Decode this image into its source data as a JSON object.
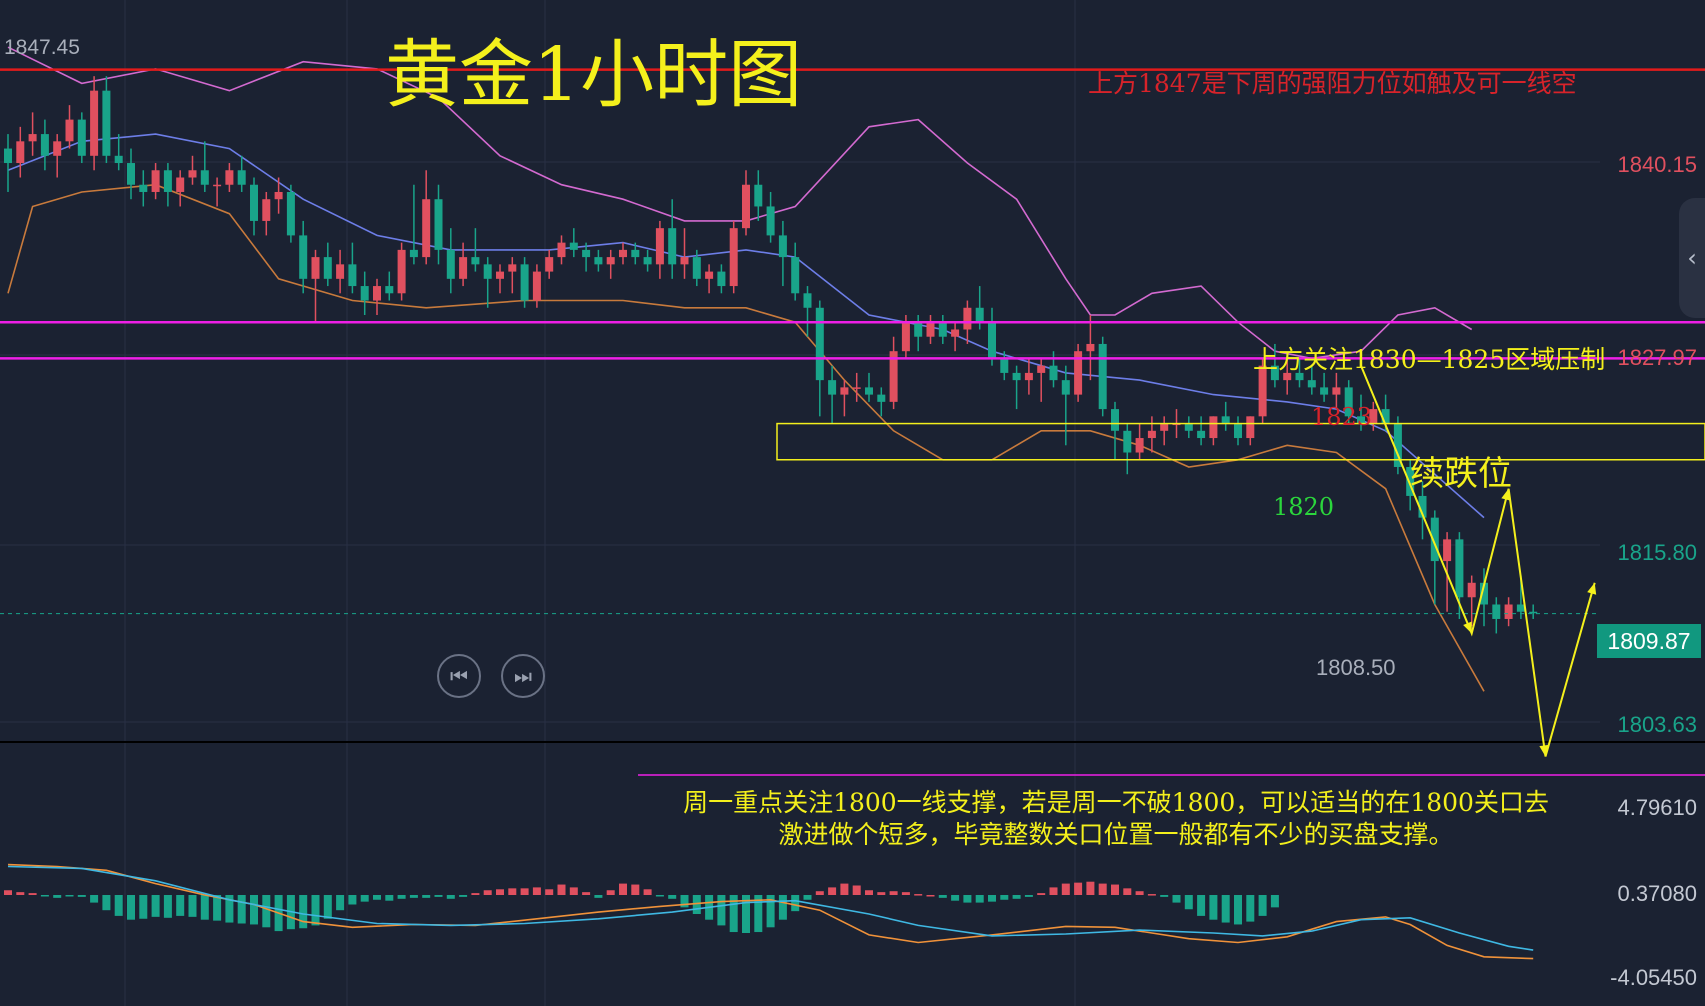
{
  "title": "黄金1小时图",
  "annotations": {
    "resistance_note": "上方1847是下周的强阻力位如触及可一线空",
    "pressure_note": "上方关注1830—1825区域压制",
    "continue_drop": "续跌位",
    "label_1823": "1823",
    "label_1820": "1820",
    "bottom_line1": "周一重点关注1800一线支撑，若是周一不破1800，可以适当的在1800关口去",
    "bottom_line2": "激进做个短多，毕竟整数关口位置一般都有不少的买盘支撑。"
  },
  "price_axis": {
    "high_label": "1847.45",
    "ticks": [
      "1840.15",
      "1827.97",
      "1815.80",
      "1803.63"
    ],
    "current_price": "1809.87",
    "low_label": "1808.50"
  },
  "macd_axis": {
    "ticks": [
      "4.79610",
      "0.37080",
      "-4.05450"
    ]
  },
  "controls": {
    "prev_icon": "skip-back-icon",
    "next_icon": "skip-forward-icon",
    "expand_icon": "chevron-left-icon"
  },
  "colors": {
    "background": "#1b2232",
    "up_candle": "#e0505f",
    "down_candle": "#19a48a",
    "resistance_line": "#e31b1b",
    "zone_line": "#ee1fe6",
    "box_line": "#f4f01c",
    "annotation_yellow": "#f4f01c",
    "boll_upper": "#d36ad0",
    "boll_mid": "#6d7ee8",
    "boll_lower": "#c87a3c"
  },
  "chart_data": {
    "type": "candlestick",
    "timeframe": "1H",
    "ylim": [
      1801.0,
      1849.5
    ],
    "horizontal_lines": [
      {
        "price": 1847.45,
        "color": "#e31b1b"
      },
      {
        "price": 1830.0,
        "color": "#ee1fe6"
      },
      {
        "price": 1827.5,
        "color": "#ee1fe6"
      }
    ],
    "zone_box": {
      "top": 1823.0,
      "bottom": 1820.5
    },
    "candles": [
      [
        1842.0,
        1843.0,
        1839.0,
        1841.0
      ],
      [
        1841.0,
        1843.5,
        1840.0,
        1842.5
      ],
      [
        1842.5,
        1844.5,
        1841.5,
        1843.0
      ],
      [
        1843.0,
        1844.0,
        1840.5,
        1841.5
      ],
      [
        1841.5,
        1843.0,
        1840.0,
        1842.5
      ],
      [
        1842.5,
        1845.0,
        1842.0,
        1844.0
      ],
      [
        1844.0,
        1844.5,
        1841.0,
        1841.5
      ],
      [
        1841.5,
        1847.0,
        1840.5,
        1846.0
      ],
      [
        1846.0,
        1847.0,
        1841.0,
        1841.5
      ],
      [
        1841.5,
        1843.0,
        1840.5,
        1841.0
      ],
      [
        1841.0,
        1842.0,
        1838.5,
        1839.5
      ],
      [
        1839.5,
        1840.5,
        1838.0,
        1839.0
      ],
      [
        1839.0,
        1841.0,
        1838.5,
        1840.5
      ],
      [
        1840.5,
        1841.0,
        1838.0,
        1839.0
      ],
      [
        1839.0,
        1840.5,
        1838.0,
        1840.0
      ],
      [
        1840.0,
        1841.5,
        1839.5,
        1840.5
      ],
      [
        1840.5,
        1842.5,
        1839.0,
        1839.5
      ],
      [
        1839.5,
        1840.0,
        1838.0,
        1839.5
      ],
      [
        1839.5,
        1841.0,
        1839.0,
        1840.5
      ],
      [
        1840.5,
        1841.5,
        1839.0,
        1839.5
      ],
      [
        1839.5,
        1840.0,
        1836.0,
        1837.0
      ],
      [
        1837.0,
        1839.0,
        1836.0,
        1838.5
      ],
      [
        1838.5,
        1840.0,
        1837.5,
        1839.0
      ],
      [
        1839.0,
        1839.5,
        1835.5,
        1836.0
      ],
      [
        1836.0,
        1837.0,
        1832.0,
        1833.0
      ],
      [
        1833.0,
        1835.0,
        1830.0,
        1834.5
      ],
      [
        1834.5,
        1835.5,
        1832.5,
        1833.0
      ],
      [
        1833.0,
        1835.0,
        1832.0,
        1834.0
      ],
      [
        1834.0,
        1835.5,
        1832.0,
        1832.5
      ],
      [
        1832.5,
        1833.5,
        1830.5,
        1831.5
      ],
      [
        1831.5,
        1833.0,
        1830.5,
        1832.5
      ],
      [
        1832.5,
        1833.5,
        1831.5,
        1832.0
      ],
      [
        1832.0,
        1835.5,
        1831.5,
        1835.0
      ],
      [
        1835.0,
        1839.5,
        1834.0,
        1834.5
      ],
      [
        1834.5,
        1840.5,
        1834.0,
        1838.5
      ],
      [
        1838.5,
        1839.5,
        1834.0,
        1835.0
      ],
      [
        1835.0,
        1836.5,
        1832.0,
        1833.0
      ],
      [
        1833.0,
        1835.5,
        1832.5,
        1834.5
      ],
      [
        1834.5,
        1836.5,
        1833.5,
        1834.0
      ],
      [
        1834.0,
        1834.5,
        1831.0,
        1833.0
      ],
      [
        1833.0,
        1834.0,
        1832.0,
        1833.5
      ],
      [
        1833.5,
        1834.5,
        1832.0,
        1834.0
      ],
      [
        1834.0,
        1834.5,
        1831.0,
        1831.5
      ],
      [
        1831.5,
        1834.0,
        1831.0,
        1833.5
      ],
      [
        1833.5,
        1835.0,
        1833.0,
        1834.5
      ],
      [
        1834.5,
        1836.0,
        1834.0,
        1835.5
      ],
      [
        1835.5,
        1836.5,
        1834.5,
        1835.0
      ],
      [
        1835.0,
        1835.5,
        1833.5,
        1834.5
      ],
      [
        1834.5,
        1835.0,
        1833.5,
        1834.0
      ],
      [
        1834.0,
        1835.0,
        1833.0,
        1834.5
      ],
      [
        1834.5,
        1835.5,
        1834.0,
        1835.0
      ],
      [
        1835.0,
        1835.5,
        1834.0,
        1834.5
      ],
      [
        1834.5,
        1835.0,
        1833.5,
        1834.0
      ],
      [
        1834.0,
        1837.0,
        1833.0,
        1836.5
      ],
      [
        1836.5,
        1838.5,
        1833.0,
        1834.0
      ],
      [
        1834.0,
        1836.5,
        1833.0,
        1834.5
      ],
      [
        1834.5,
        1835.0,
        1832.5,
        1833.0
      ],
      [
        1833.0,
        1834.0,
        1832.0,
        1833.5
      ],
      [
        1833.5,
        1834.0,
        1832.0,
        1832.5
      ],
      [
        1832.5,
        1837.0,
        1832.0,
        1836.5
      ],
      [
        1836.5,
        1840.5,
        1836.0,
        1839.5
      ],
      [
        1839.5,
        1840.5,
        1837.0,
        1838.0
      ],
      [
        1838.0,
        1839.0,
        1835.5,
        1836.0
      ],
      [
        1836.0,
        1837.0,
        1832.5,
        1834.5
      ],
      [
        1834.5,
        1835.5,
        1831.5,
        1832.0
      ],
      [
        1832.0,
        1832.5,
        1829.0,
        1831.0
      ],
      [
        1831.0,
        1831.5,
        1823.5,
        1826.0
      ],
      [
        1826.0,
        1827.0,
        1823.0,
        1825.0
      ],
      [
        1825.0,
        1826.0,
        1823.5,
        1825.5
      ],
      [
        1825.5,
        1826.5,
        1824.5,
        1825.5
      ],
      [
        1825.5,
        1826.5,
        1824.5,
        1825.0
      ],
      [
        1825.0,
        1825.5,
        1823.5,
        1824.5
      ],
      [
        1824.5,
        1829.0,
        1824.0,
        1828.0
      ],
      [
        1828.0,
        1830.5,
        1827.5,
        1830.0
      ],
      [
        1830.0,
        1830.5,
        1828.0,
        1829.0
      ],
      [
        1829.0,
        1830.5,
        1828.5,
        1830.0
      ],
      [
        1830.0,
        1830.5,
        1828.5,
        1829.0
      ],
      [
        1829.0,
        1830.0,
        1828.0,
        1829.5
      ],
      [
        1829.5,
        1831.5,
        1828.5,
        1831.0
      ],
      [
        1831.0,
        1832.5,
        1829.5,
        1830.0
      ],
      [
        1830.0,
        1831.0,
        1827.0,
        1827.5
      ],
      [
        1827.5,
        1828.0,
        1826.0,
        1826.5
      ],
      [
        1826.5,
        1827.0,
        1824.0,
        1826.0
      ],
      [
        1826.0,
        1827.5,
        1825.0,
        1826.5
      ],
      [
        1826.5,
        1827.5,
        1824.5,
        1827.0
      ],
      [
        1827.0,
        1828.0,
        1825.5,
        1826.0
      ],
      [
        1826.0,
        1827.0,
        1821.5,
        1825.0
      ],
      [
        1825.0,
        1828.5,
        1824.5,
        1828.0
      ],
      [
        1828.0,
        1830.5,
        1826.0,
        1828.5
      ],
      [
        1828.5,
        1829.0,
        1823.5,
        1824.0
      ],
      [
        1824.0,
        1824.5,
        1820.5,
        1822.5
      ],
      [
        1822.5,
        1823.0,
        1819.5,
        1821.0
      ],
      [
        1821.0,
        1823.0,
        1820.5,
        1822.0
      ],
      [
        1822.0,
        1823.5,
        1821.0,
        1822.5
      ],
      [
        1822.5,
        1823.5,
        1821.5,
        1823.0
      ],
      [
        1823.0,
        1824.0,
        1822.0,
        1823.0
      ],
      [
        1823.0,
        1823.5,
        1822.0,
        1822.5
      ],
      [
        1822.5,
        1823.5,
        1821.5,
        1822.0
      ],
      [
        1822.0,
        1823.5,
        1821.5,
        1823.5
      ],
      [
        1823.5,
        1824.5,
        1822.5,
        1823.0
      ],
      [
        1823.0,
        1823.5,
        1821.5,
        1822.0
      ],
      [
        1822.0,
        1823.5,
        1821.5,
        1823.5
      ],
      [
        1823.5,
        1827.5,
        1823.0,
        1827.0
      ],
      [
        1827.0,
        1828.5,
        1825.5,
        1826.0
      ],
      [
        1826.0,
        1827.5,
        1825.0,
        1826.5
      ],
      [
        1826.5,
        1827.5,
        1825.5,
        1826.0
      ],
      [
        1826.0,
        1827.0,
        1825.0,
        1825.5
      ],
      [
        1825.5,
        1826.5,
        1824.5,
        1825.0
      ],
      [
        1825.0,
        1826.5,
        1824.0,
        1825.5
      ],
      [
        1825.5,
        1826.0,
        1823.0,
        1823.5
      ],
      [
        1823.5,
        1825.0,
        1822.5,
        1823.0
      ],
      [
        1823.0,
        1824.5,
        1822.5,
        1824.0
      ],
      [
        1824.0,
        1825.0,
        1822.5,
        1823.0
      ],
      [
        1823.0,
        1823.5,
        1819.5,
        1820.0
      ],
      [
        1820.0,
        1820.5,
        1817.0,
        1818.0
      ],
      [
        1818.0,
        1819.0,
        1815.0,
        1816.5
      ],
      [
        1816.5,
        1817.0,
        1810.5,
        1813.5
      ],
      [
        1813.5,
        1815.5,
        1810.0,
        1815.0
      ],
      [
        1815.0,
        1815.5,
        1809.5,
        1811.0
      ],
      [
        1811.0,
        1812.5,
        1809.0,
        1812.0
      ],
      [
        1812.0,
        1813.0,
        1809.0,
        1810.5
      ],
      [
        1810.5,
        1811.0,
        1808.5,
        1809.5
      ],
      [
        1809.5,
        1811.0,
        1809.0,
        1810.5
      ],
      [
        1810.5,
        1812.5,
        1809.5,
        1810.0
      ],
      [
        1810.0,
        1810.5,
        1809.5,
        1809.9
      ]
    ],
    "boll_upper": [
      [
        0,
        1849.0
      ],
      [
        6,
        1846.5
      ],
      [
        12,
        1847.5
      ],
      [
        18,
        1846.0
      ],
      [
        24,
        1848.0
      ],
      [
        30,
        1847.5
      ],
      [
        35,
        1845.5
      ],
      [
        40,
        1841.5
      ],
      [
        45,
        1839.5
      ],
      [
        50,
        1838.5
      ],
      [
        55,
        1837.0
      ],
      [
        60,
        1837.0
      ],
      [
        64,
        1838.0
      ],
      [
        70,
        1843.5
      ],
      [
        74,
        1844.0
      ],
      [
        78,
        1841.0
      ],
      [
        82,
        1838.5
      ],
      [
        86,
        1833.0
      ],
      [
        88,
        1830.5
      ],
      [
        90,
        1830.5
      ],
      [
        93,
        1832.0
      ],
      [
        97,
        1832.5
      ],
      [
        100,
        1830.0
      ],
      [
        103,
        1828.0
      ],
      [
        106,
        1827.5
      ],
      [
        110,
        1828.0
      ],
      [
        113,
        1830.5
      ],
      [
        116,
        1831.0
      ],
      [
        119,
        1829.5
      ]
    ],
    "boll_mid": [
      [
        0,
        1840.5
      ],
      [
        6,
        1842.5
      ],
      [
        12,
        1843.0
      ],
      [
        18,
        1842.0
      ],
      [
        24,
        1838.5
      ],
      [
        30,
        1836.0
      ],
      [
        36,
        1835.0
      ],
      [
        44,
        1835.0
      ],
      [
        50,
        1835.5
      ],
      [
        55,
        1834.5
      ],
      [
        60,
        1835.0
      ],
      [
        64,
        1834.5
      ],
      [
        70,
        1830.5
      ],
      [
        76,
        1829.5
      ],
      [
        80,
        1828.0
      ],
      [
        86,
        1826.5
      ],
      [
        92,
        1826.0
      ],
      [
        98,
        1825.0
      ],
      [
        104,
        1824.5
      ],
      [
        108,
        1824.0
      ],
      [
        112,
        1822.5
      ],
      [
        116,
        1819.5
      ],
      [
        120,
        1816.5
      ]
    ],
    "boll_lower": [
      [
        0,
        1832.0
      ],
      [
        2,
        1838.0
      ],
      [
        6,
        1839.0
      ],
      [
        12,
        1839.5
      ],
      [
        18,
        1837.5
      ],
      [
        22,
        1833.0
      ],
      [
        28,
        1831.5
      ],
      [
        34,
        1831.0
      ],
      [
        42,
        1831.5
      ],
      [
        50,
        1831.5
      ],
      [
        55,
        1831.0
      ],
      [
        60,
        1831.0
      ],
      [
        64,
        1830.0
      ],
      [
        68,
        1826.0
      ],
      [
        72,
        1822.5
      ],
      [
        76,
        1820.5
      ],
      [
        80,
        1820.5
      ],
      [
        84,
        1822.5
      ],
      [
        88,
        1822.5
      ],
      [
        92,
        1821.5
      ],
      [
        96,
        1820.0
      ],
      [
        100,
        1820.5
      ],
      [
        104,
        1821.5
      ],
      [
        108,
        1821.0
      ],
      [
        112,
        1818.5
      ],
      [
        116,
        1810.5
      ],
      [
        120,
        1804.5
      ]
    ],
    "projection": [
      [
        110,
        1827.0
      ],
      [
        119,
        1808.5
      ],
      [
        122,
        1818.5
      ],
      [
        125,
        1800.0
      ],
      [
        129,
        1812.0
      ]
    ],
    "macd_hist": [
      0.5,
      0.3,
      0.2,
      -0.1,
      -0.3,
      -0.1,
      -0.2,
      -0.8,
      -1.6,
      -2.2,
      -2.6,
      -2.5,
      -2.3,
      -2.4,
      -2.2,
      -2.3,
      -2.6,
      -2.7,
      -2.9,
      -3.0,
      -3.1,
      -3.4,
      -3.8,
      -3.6,
      -3.5,
      -3.2,
      -2.5,
      -1.6,
      -1.0,
      -0.7,
      -0.5,
      -0.6,
      -0.4,
      -0.3,
      -0.3,
      -0.2,
      -0.4,
      -0.2,
      0.2,
      0.5,
      0.6,
      0.7,
      0.7,
      0.8,
      0.6,
      1.1,
      0.8,
      0.3,
      -0.3,
      0.5,
      1.2,
      1.1,
      0.6,
      -0.1,
      -0.4,
      -1.3,
      -2.0,
      -2.6,
      -3.2,
      -3.9,
      -4.0,
      -3.9,
      -3.4,
      -2.6,
      -1.7,
      -0.5,
      0.4,
      0.8,
      1.2,
      1.0,
      0.5,
      0.3,
      0.4,
      0.3,
      0.1,
      0.0,
      -0.3,
      -0.6,
      -0.8,
      -0.8,
      -0.7,
      -0.5,
      -0.4,
      -0.2,
      0.2,
      0.8,
      1.2,
      1.3,
      1.4,
      1.2,
      1.1,
      0.7,
      0.4,
      0.1,
      -0.2,
      -0.8,
      -1.5,
      -2.2,
      -2.6,
      -2.9,
      -3.1,
      -2.8,
      -2.2,
      -1.3
    ],
    "macd_dif": [
      [
        0,
        3.2
      ],
      [
        4,
        3.0
      ],
      [
        8,
        2.6
      ],
      [
        12,
        1.2
      ],
      [
        16,
        0.0
      ],
      [
        20,
        -1.0
      ],
      [
        24,
        -2.8
      ],
      [
        28,
        -3.4
      ],
      [
        33,
        -3.1
      ],
      [
        38,
        -3.2
      ],
      [
        43,
        -2.5
      ],
      [
        48,
        -1.8
      ],
      [
        53,
        -1.2
      ],
      [
        58,
        -0.7
      ],
      [
        62,
        -0.5
      ],
      [
        66,
        -1.6
      ],
      [
        70,
        -4.2
      ],
      [
        74,
        -5.0
      ],
      [
        80,
        -4.2
      ],
      [
        86,
        -3.3
      ],
      [
        90,
        -3.4
      ],
      [
        96,
        -4.6
      ],
      [
        100,
        -5.0
      ],
      [
        104,
        -4.4
      ],
      [
        108,
        -2.8
      ],
      [
        112,
        -2.3
      ],
      [
        114,
        -3.1
      ],
      [
        117,
        -5.3
      ],
      [
        120,
        -6.5
      ],
      [
        124,
        -6.7
      ]
    ],
    "macd_dea": [
      [
        0,
        3.0
      ],
      [
        6,
        2.8
      ],
      [
        12,
        1.5
      ],
      [
        18,
        -0.5
      ],
      [
        24,
        -2.0
      ],
      [
        30,
        -3.0
      ],
      [
        36,
        -3.2
      ],
      [
        42,
        -3.0
      ],
      [
        48,
        -2.5
      ],
      [
        54,
        -1.8
      ],
      [
        60,
        -0.8
      ],
      [
        64,
        -0.6
      ],
      [
        70,
        -2.0
      ],
      [
        74,
        -3.2
      ],
      [
        80,
        -4.3
      ],
      [
        86,
        -4.1
      ],
      [
        92,
        -3.7
      ],
      [
        98,
        -4.0
      ],
      [
        102,
        -4.3
      ],
      [
        106,
        -3.8
      ],
      [
        110,
        -2.6
      ],
      [
        114,
        -2.4
      ],
      [
        118,
        -4.0
      ],
      [
        122,
        -5.4
      ],
      [
        124,
        -5.8
      ]
    ]
  }
}
